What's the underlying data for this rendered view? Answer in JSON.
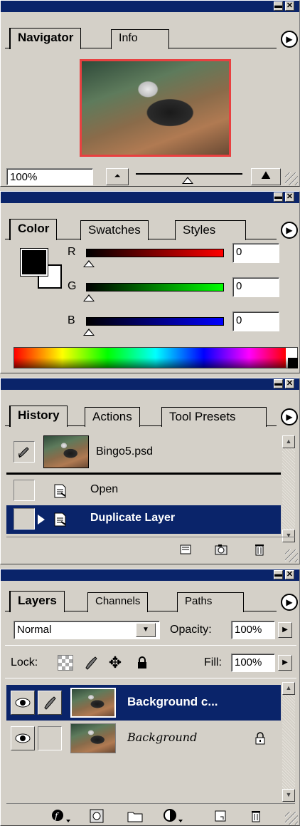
{
  "navigator": {
    "tabs": [
      "Navigator",
      "Info"
    ],
    "zoom_value": "100%"
  },
  "color": {
    "tabs": [
      "Color",
      "Swatches",
      "Styles"
    ],
    "channels": [
      {
        "label": "R",
        "value": "0",
        "color": "#ff0000"
      },
      {
        "label": "G",
        "value": "0",
        "color": "#00ff00"
      },
      {
        "label": "B",
        "value": "0",
        "color": "#0000ff"
      }
    ],
    "foreground": "#000000",
    "background": "#ffffff"
  },
  "history": {
    "tabs": [
      "History",
      "Actions",
      "Tool Presets"
    ],
    "snapshot_name": "Bingo5.psd",
    "states": [
      {
        "label": "Open",
        "selected": false
      },
      {
        "label": "Duplicate Layer",
        "selected": true
      }
    ]
  },
  "layers": {
    "tabs": [
      "Layers",
      "Channels",
      "Paths"
    ],
    "blend_mode": "Normal",
    "opacity_label": "Opacity:",
    "opacity_value": "100%",
    "lock_label": "Lock:",
    "fill_label": "Fill:",
    "fill_value": "100%",
    "items": [
      {
        "name": "Background c...",
        "selected": true,
        "visible": true,
        "locked": false
      },
      {
        "name": "Background",
        "selected": false,
        "visible": true,
        "locked": true
      }
    ]
  },
  "colors": {
    "titlebar": "#0a246a",
    "selection": "#0a246a",
    "panel": "#d4d0c8"
  }
}
